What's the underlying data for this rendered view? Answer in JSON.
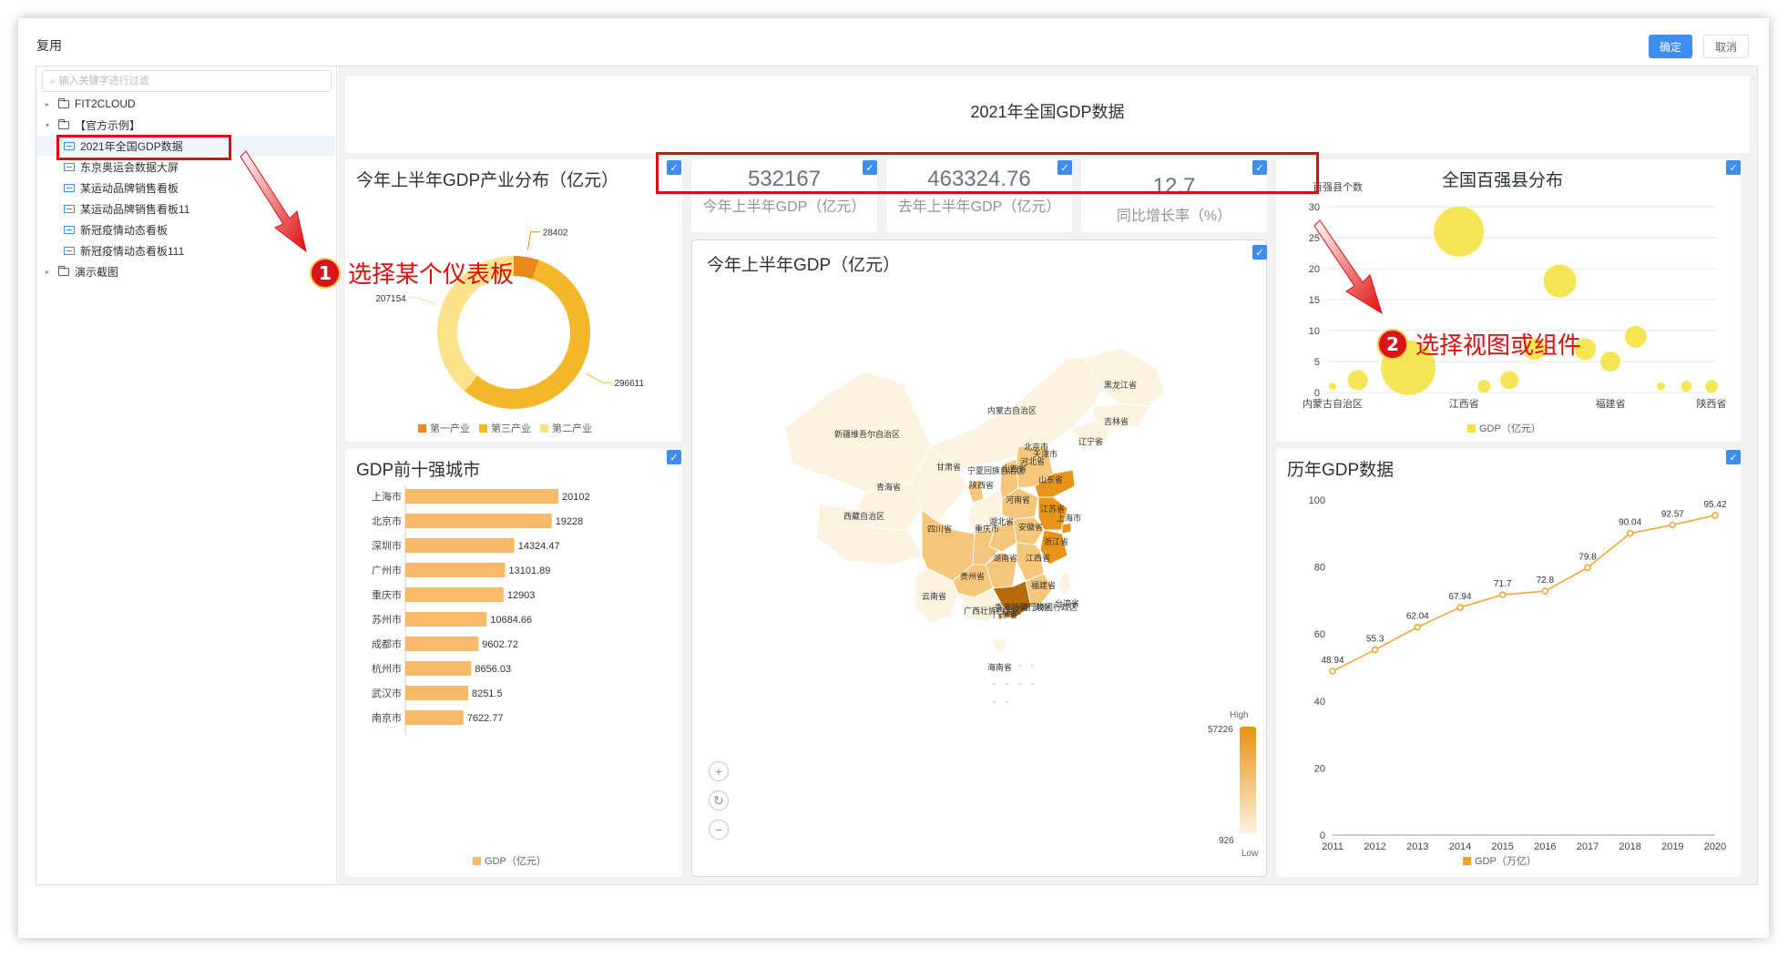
{
  "dialog": {
    "title": "复用",
    "confirm_label": "确定",
    "cancel_label": "取消"
  },
  "sidebar": {
    "search_placeholder": "输入关键字进行过滤",
    "tree": [
      {
        "label": "FIT2CLOUD",
        "type": "folder"
      },
      {
        "label": "【官方示例】",
        "type": "folder"
      },
      {
        "label": "2021年全国GDP数据",
        "type": "dashboard",
        "selected": true
      },
      {
        "label": "东京奥运会数据大屏",
        "type": "dashboard"
      },
      {
        "label": "某运动品牌销售看板",
        "type": "dashboard"
      },
      {
        "label": "某运动品牌销售看板11",
        "type": "dashboard"
      },
      {
        "label": "新冠疫情动态看板",
        "type": "dashboard"
      },
      {
        "label": "新冠疫情动态看板111",
        "type": "dashboard"
      },
      {
        "label": "演示截图",
        "type": "folder"
      }
    ]
  },
  "annotations": {
    "step1": {
      "num": "1",
      "text": "选择某个仪表板"
    },
    "step2": {
      "num": "2",
      "text": "选择视图或组件"
    }
  },
  "dashboard": {
    "title": "2021年全国GDP数据",
    "kpis": [
      {
        "value": "532167",
        "label": "今年上半年GDP（亿元）"
      },
      {
        "value": "463324.76",
        "label": "去年上半年GDP（亿元）"
      },
      {
        "value": "12.7",
        "label": "同比增长率（%）"
      }
    ],
    "map": {
      "title": "今年上半年GDP（亿元）",
      "high_label": "High",
      "low_label": "Low",
      "max_value": "57226",
      "min_value": "926",
      "regions": [
        "黑龙江省",
        "吉林省",
        "辽宁省",
        "内蒙古自治区",
        "新疆维吾尔自治区",
        "甘肃省",
        "宁夏回族自治区",
        "青海省",
        "西藏自治区",
        "四川省",
        "重庆市",
        "陕西省",
        "山西省",
        "北京市",
        "天津市",
        "河北省",
        "山东省",
        "河南省",
        "江苏省",
        "安徽省",
        "上海市",
        "湖北省",
        "浙江省",
        "湖南省",
        "江西省",
        "贵州省",
        "云南省",
        "广西壮族自治区",
        "广东省",
        "福建省",
        "台湾省",
        "海南省",
        "香港特别行政区",
        "澳门特别行政区"
      ],
      "colors": {
        "low": "#fdf3e1",
        "mid": "#f6c77a",
        "high": "#e89419",
        "max": "#b86a05"
      }
    }
  },
  "chart_data": [
    {
      "type": "pie",
      "title": "今年上半年GDP产业分布（亿元）",
      "labels": [
        "第一产业",
        "第三产业",
        "第二产业"
      ],
      "values": [
        28402,
        296611,
        207154
      ],
      "colors": [
        "#e8891a",
        "#f4b728",
        "#fbe28b"
      ]
    },
    {
      "type": "bar",
      "title": "GDP前十强城市",
      "categories": [
        "上海市",
        "北京市",
        "深圳市",
        "广州市",
        "重庆市",
        "苏州市",
        "成都市",
        "杭州市",
        "武汉市",
        "南京市"
      ],
      "values": [
        20102,
        19228,
        14324.47,
        13101.89,
        12903,
        10684.66,
        9602.72,
        8656.03,
        8251.5,
        7622.77
      ],
      "value_labels": [
        "20102",
        "19228",
        "14324.47",
        "13101.89",
        "12903",
        "10684.66",
        "9602.72",
        "8656.03",
        "8251.5",
        "7622.77"
      ],
      "legend": "GDP（亿元）",
      "color": "#f8b968"
    },
    {
      "type": "scatter",
      "title": "全国百强县分布",
      "ylabel": "百强县个数",
      "ylim": [
        0,
        30
      ],
      "yticks": [
        0,
        5,
        10,
        15,
        20,
        25,
        30
      ],
      "xlabels": [
        "内蒙古自治区",
        "江西省",
        "福建省",
        "陕西省"
      ],
      "points": [
        {
          "x": 0.0,
          "y": 1,
          "size": 8
        },
        {
          "x": 1.0,
          "y": 2,
          "size": 22
        },
        {
          "x": 3.0,
          "y": 4,
          "size": 60
        },
        {
          "x": 5.0,
          "y": 26,
          "size": 55
        },
        {
          "x": 6.0,
          "y": 1,
          "size": 14
        },
        {
          "x": 7.0,
          "y": 2,
          "size": 20
        },
        {
          "x": 8.0,
          "y": 7,
          "size": 24
        },
        {
          "x": 9.0,
          "y": 18,
          "size": 36
        },
        {
          "x": 10.0,
          "y": 7,
          "size": 24
        },
        {
          "x": 11.0,
          "y": 5,
          "size": 22
        },
        {
          "x": 12.0,
          "y": 9,
          "size": 24
        },
        {
          "x": 13.0,
          "y": 1,
          "size": 9
        },
        {
          "x": 14.0,
          "y": 1,
          "size": 12
        },
        {
          "x": 15.0,
          "y": 1,
          "size": 14
        }
      ],
      "legend": "GDP（亿元）",
      "color": "#f2e23a"
    },
    {
      "type": "line",
      "title": "历年GDP数据",
      "x": [
        "2011",
        "2012",
        "2013",
        "2014",
        "2015",
        "2016",
        "2017",
        "2018",
        "2019",
        "2020"
      ],
      "values": [
        48.94,
        55.3,
        62.04,
        67.94,
        71.7,
        72.8,
        79.8,
        90.04,
        92.57,
        95.42
      ],
      "value_labels": [
        "48.94",
        "55.3",
        "62.04",
        "67.94",
        "71.7",
        "72.8",
        "79.8",
        "90.04",
        "92.57",
        "95.42"
      ],
      "ylim": [
        0,
        100
      ],
      "yticks": [
        0,
        20,
        40,
        60,
        80,
        100
      ],
      "legend": "GDP（万亿）",
      "color": "#f3a32a"
    }
  ]
}
